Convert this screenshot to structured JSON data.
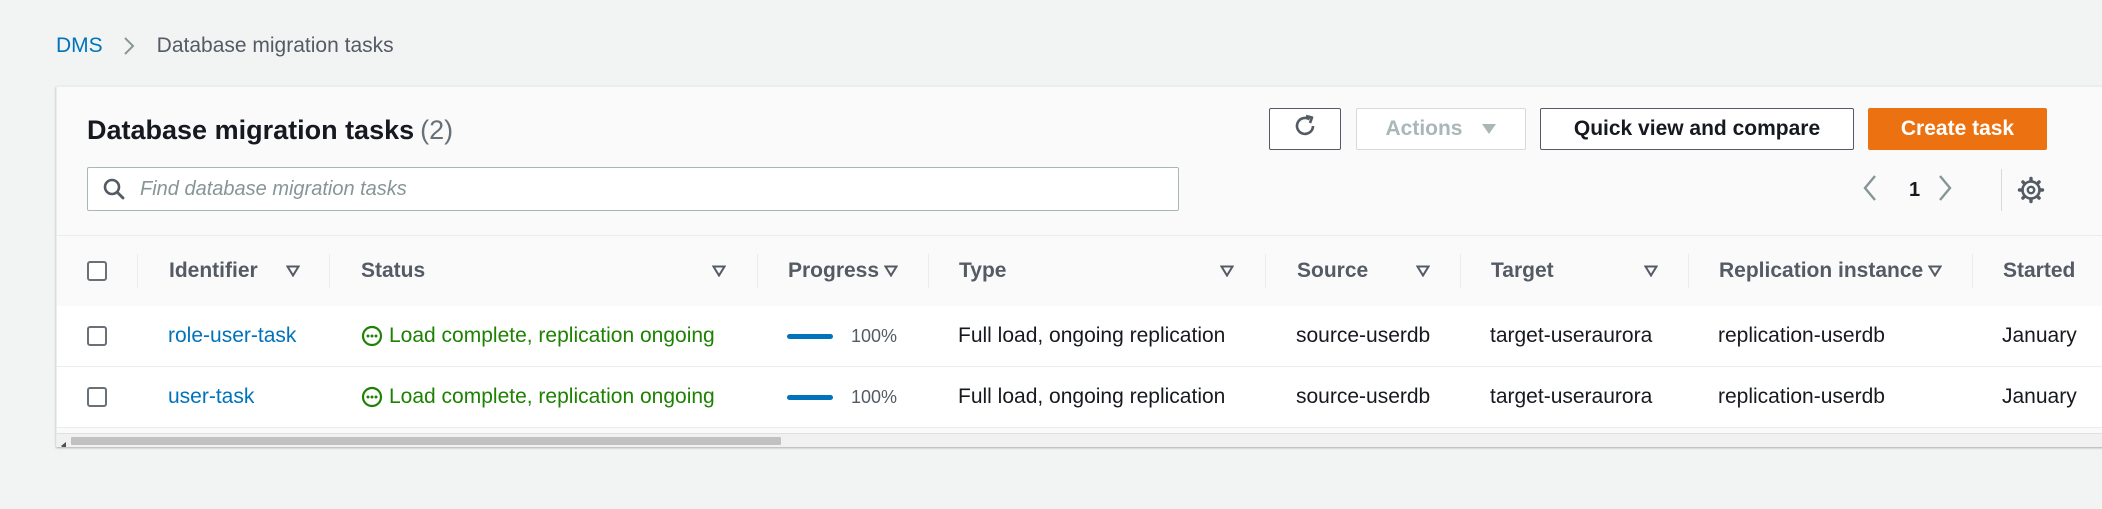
{
  "breadcrumb": {
    "root": "DMS",
    "current": "Database migration tasks"
  },
  "header": {
    "title": "Database migration tasks",
    "count": "(2)"
  },
  "toolbar": {
    "actions_label": "Actions",
    "quick_view_label": "Quick view and compare",
    "create_label": "Create task"
  },
  "search": {
    "placeholder": "Find database migration tasks",
    "value": ""
  },
  "pagination": {
    "current_page": "1"
  },
  "table": {
    "columns": [
      "Identifier",
      "Status",
      "Progress",
      "Type",
      "Source",
      "Target",
      "Replication instance",
      "Started"
    ],
    "rows": [
      {
        "identifier": "role-user-task",
        "status": "Load complete, replication ongoing",
        "progress": "100%",
        "progress_value": 1.0,
        "type": "Full load, ongoing replication",
        "source": "source-userdb",
        "target": "target-useraurora",
        "replication_instance": "replication-userdb",
        "started": "January"
      },
      {
        "identifier": "user-task",
        "status": "Load complete, replication ongoing",
        "progress": "100%",
        "progress_value": 1.0,
        "type": "Full load, ongoing replication",
        "source": "source-userdb",
        "target": "target-useraurora",
        "replication_instance": "replication-userdb",
        "started": "January"
      }
    ]
  },
  "colors": {
    "link": "#0073bb",
    "primary": "#ec7211",
    "success": "#1d8102",
    "text": "#16191f",
    "muted": "#545b64"
  },
  "icons": [
    "chevron-right-icon",
    "refresh-icon",
    "caret-down-icon",
    "search-icon",
    "chevron-left-icon",
    "gear-icon",
    "sort-icon",
    "status-in-progress-icon"
  ]
}
